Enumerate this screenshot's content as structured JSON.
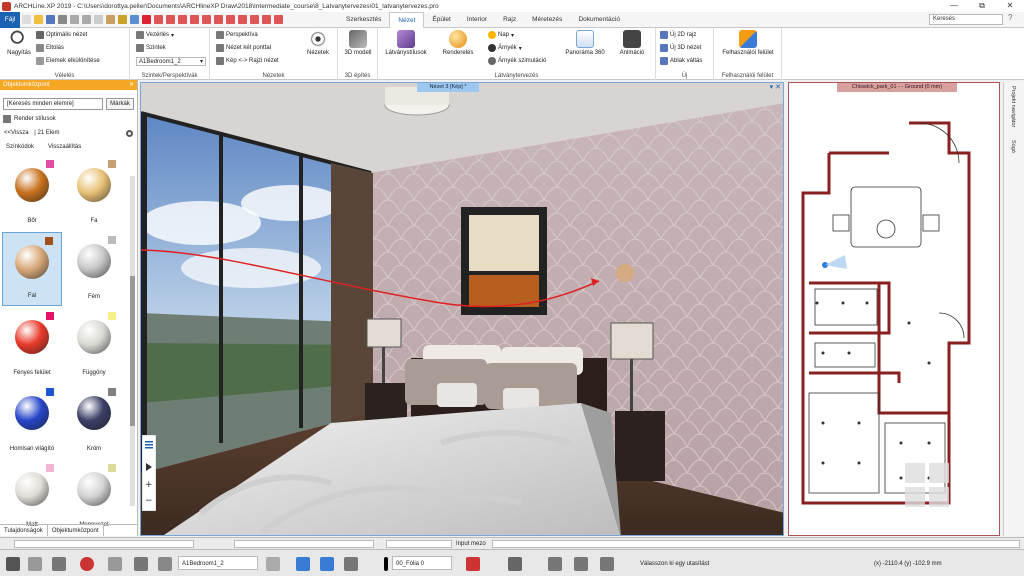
{
  "titlebar": {
    "title": "ARCHLine.XP 2019 - C:\\Users\\dorottya.peller\\Documents\\ARCHlineXP Draw\\2018\\Intermediate_course\\8_Latvanytervezes\\01_latvanytervezes.pro",
    "minimize": "—",
    "maximize": "⧉",
    "close": "✕"
  },
  "tabs": {
    "file": "Fájl",
    "items": [
      "Szerkesztés",
      "Nézet",
      "Épület",
      "Interior",
      "Rajz",
      "Méretezés",
      "Dokumentáció"
    ],
    "active_index": 1,
    "search_placeholder": "Keresés",
    "help": "?"
  },
  "ribbon": {
    "groups": {
      "view": "Vélelés",
      "levels": "Szintek/Perspektívák",
      "views": "Nézetek",
      "build3d": "3D építés",
      "visual": "Látványtervezés",
      "new": "Új",
      "ui": "Felhasználói felület"
    },
    "items": {
      "zoom": "Nagyítás",
      "optimal": "Optimális nézet",
      "pan": "Eltolás",
      "hide": "Elemek elkülönítése",
      "guides": "Vezérlés",
      "levels": "Szintek",
      "level_select": "A1Bedroom1_2",
      "perspective": "Perspektíva",
      "twopoint": "Nézet két ponttal",
      "imagedraw": "Kép <-> Rajzi nézet",
      "views_btn": "Nézetek",
      "model3d": "3D modell",
      "styles": "Látványstílusok",
      "render": "Renderelés",
      "sun": "Nap",
      "shadow": "Árnyék",
      "shadow_sim": "Árnyék szimuláció",
      "panorama": "Panoráma 360",
      "animation": "Animáció",
      "new2d": "Új 2D rajz",
      "new3d": "Új 3D nézet",
      "window_switch": "Ablak váltás",
      "ui_btn": "Felhasználói felület"
    }
  },
  "leftpanel": {
    "title": "Objektumközpont",
    "pin": "✕",
    "search_value": "[Keresés minden elemre]",
    "markers": "Márkák",
    "path": "Render stílusok",
    "back": "<<Vissza",
    "count": "| 21 Elem",
    "col_color": "Színkódok",
    "col_reflect": "Visszaállítás",
    "materials": [
      {
        "label": "Bőr",
        "sphere": "#c8721e",
        "swatch": "#e04ca8"
      },
      {
        "label": "Fa",
        "sphere": "#e8c277",
        "swatch": "#c8a070"
      },
      {
        "label": "Fal",
        "sphere": "#d8a97a",
        "swatch": "#a0501a"
      },
      {
        "label": "Fém",
        "sphere": "#c8c8c8",
        "swatch": "#bbbbbb"
      },
      {
        "label": "Fényes felület",
        "sphere": "#e83a2a",
        "swatch": "#e4136a"
      },
      {
        "label": "Függöny",
        "sphere": "#d9d9d4",
        "swatch": "#f3f08a"
      },
      {
        "label": "Homlsan világító",
        "sphere": "#2746c9",
        "swatch": "#1e56d0"
      },
      {
        "label": "Króm",
        "sphere": "#3b3f66",
        "swatch": "#808080"
      },
      {
        "label": "Matt",
        "sphere": "#e0dcd6",
        "swatch": "#f0b6d4"
      },
      {
        "label": "Mennyezet",
        "sphere": "#d4d4d4",
        "swatch": "#dcdc9a"
      }
    ],
    "selected_index": 2,
    "tab_props": "Tulajdonságok",
    "tab_center": "Objektumközpont"
  },
  "view3d": {
    "tab": "Nézet 3 [Kép] *",
    "controls": "▾ ✕"
  },
  "view2d": {
    "tab": "Chiswick_park_01 - - Ground (0 mm)"
  },
  "rightbar": {
    "navigator": "Projekt navigátor",
    "help": "Súgó"
  },
  "inputrow": {
    "label": "Input mezo"
  },
  "statusbar": {
    "level": "A1Bedroom1_2",
    "layer": "00_Fólia 0",
    "message": "Válasszon ki egy utasítást",
    "coords": "(x) -2110.4  (y) -102.9 mm"
  },
  "colors": {
    "accent": "#1b62b2",
    "panel_header": "#f5a623",
    "wall_red": "#8a1f1f"
  }
}
